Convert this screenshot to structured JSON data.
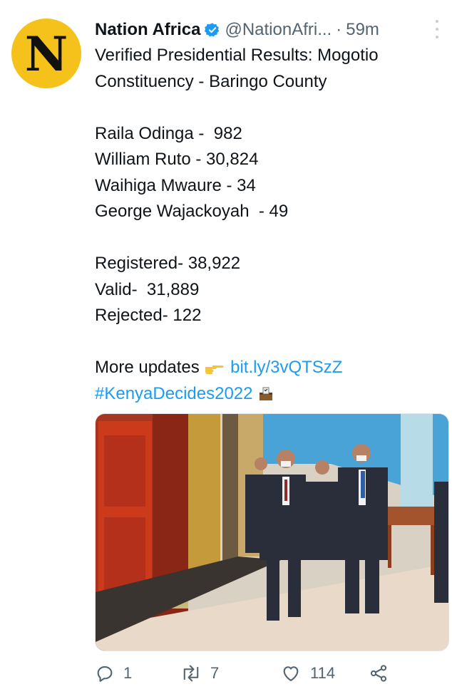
{
  "tweet": {
    "avatar_letter": "N",
    "author_name": "Nation Africa",
    "handle": "@NationAfri...",
    "separator": "·",
    "time": "59m",
    "lines": [
      "Verified Presidential Results: Mogotio",
      "Constituency - Baringo County"
    ],
    "results": [
      "Raila Odinga -  982",
      "William Ruto - 30,824",
      "Waihiga Mwaure - 34",
      "George Wajackoyah  - 49"
    ],
    "totals": [
      "Registered- 38,922",
      "Valid-  31,889",
      "Rejected- 122"
    ],
    "more_updates_label": "More updates",
    "link": "bit.ly/3vQTSzZ",
    "hashtag": "#KenyaDecides2022"
  },
  "actions": {
    "replies": "1",
    "retweets": "7",
    "likes": "114"
  },
  "colors": {
    "avatar_bg": "#f5c21b",
    "link": "#1d9bf0",
    "verified": "#1d9bf0",
    "muted": "#536471"
  },
  "icons": [
    "verified-badge-icon",
    "more-icon",
    "pointing-hand-icon",
    "ballot-box-icon",
    "reply-icon",
    "retweet-icon",
    "like-icon",
    "share-icon"
  ]
}
